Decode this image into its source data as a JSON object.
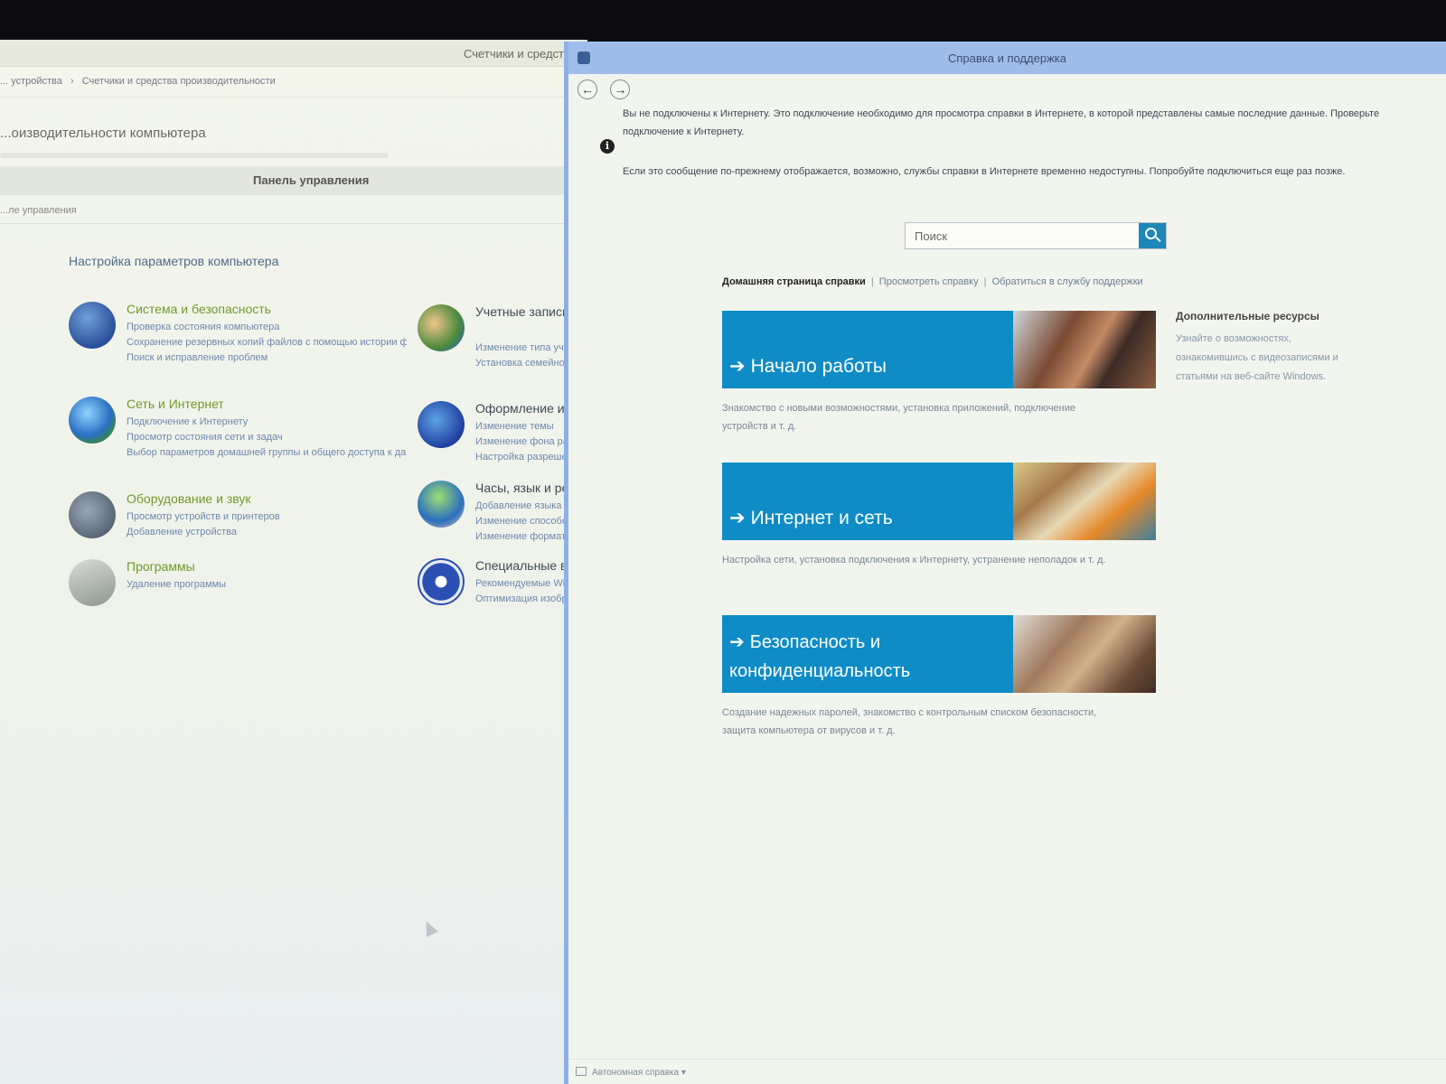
{
  "control_panel": {
    "window_title": "Счетчики и средства",
    "address_crumbs": [
      "... устройства",
      "›",
      "Счетчики и средства производительности"
    ],
    "perf_title": "...оизводительности компьютера",
    "panel_header": "Панель управления",
    "crumb2": "...ле управления",
    "settings_title": "Настройка параметров компьютера",
    "categories": [
      {
        "title": "Система и безопасность",
        "icon": "shield-icon",
        "links": [
          "Проверка состояния компьютера",
          "Сохранение резервных копий файлов с помощью истории файлов",
          "Поиск и исправление проблем"
        ]
      },
      {
        "title": "Сеть и Интернет",
        "icon": "network-globe-icon",
        "links": [
          "Подключение к Интернету",
          "Просмотр состояния сети и задач",
          "Выбор параметров домашней группы и общего доступа к данным"
        ]
      },
      {
        "title": "Оборудование и звук",
        "icon": "printer-icon",
        "links": [
          "Просмотр устройств и принтеров",
          "Добавление устройства"
        ]
      },
      {
        "title": "Программы",
        "icon": "programs-icon",
        "links": [
          "Удаление программы"
        ]
      },
      {
        "title": "Учетные записи и семейная безопасность",
        "icon": "users-icon",
        "links": [
          "Изменение типа учетной записи",
          "Установка семейной безопасности для пользователя"
        ]
      },
      {
        "title": "Оформление и персонализация",
        "icon": "appearance-icon",
        "links": [
          "Изменение темы",
          "Изменение фона рабочего стола",
          "Настройка разрешения экрана"
        ]
      },
      {
        "title": "Часы, язык и регион",
        "icon": "clock-globe-icon",
        "links": [
          "Добавление языка",
          "Изменение способов ввода",
          "Изменение форматов даты, времени или чисел"
        ]
      },
      {
        "title": "Специальные возможности",
        "icon": "accessibility-icon",
        "links": [
          "Рекомендуемые Windows параметры",
          "Оптимизация изображения на экране"
        ]
      }
    ]
  },
  "help": {
    "window_title": "Справка и поддержка",
    "back_label": "←",
    "forward_label": "→",
    "info_symbol": "i",
    "message_1": "Вы не подключены к Интернету. Это подключение необходимо для просмотра справки в Интернете, в которой представлены самые последние данные. Проверьте подключение к Интернету.",
    "message_2": "Если это сообщение по-прежнему отображается, возможно, службы справки в Интернете временно недоступны. Попробуйте подключиться еще раз позже.",
    "search_placeholder": "Поиск",
    "homenav": {
      "current": "Домашняя страница справки",
      "sep": "|",
      "browse": "Просмотреть справку",
      "contact": "Обратиться в службу поддержки"
    },
    "tiles": [
      {
        "arrow": "➔",
        "title": "Начало работы",
        "desc": "Знакомство с новыми возможностями, установка приложений, подключение устройств и т. д."
      },
      {
        "arrow": "➔",
        "title": "Интернет и сеть",
        "desc": "Настройка сети, установка подключения к Интернету, устранение неполадок и т. д."
      },
      {
        "arrow": "➔",
        "title": "Безопасность и конфиденциальность",
        "desc": "Создание надежных паролей, знакомство с контрольным списком безопасности, защита компьютера от вирусов и т. д."
      }
    ],
    "side": {
      "title": "Дополнительные ресурсы",
      "text": "Узнайте о возможностях, ознакомившись с видеозаписями и статьями на веб-сайте Windows."
    },
    "status": "Автономная справка ▾"
  },
  "colors": {
    "tile_blue": "#0f8cc6",
    "help_titlebar": "#9fbde9",
    "category_green": "#6f9a2c",
    "link_blue": "#6c88b0"
  }
}
